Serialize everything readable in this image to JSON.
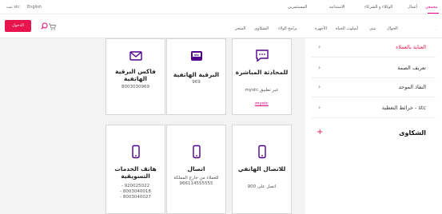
{
  "topbar": {
    "segments": [
      "مجمعي",
      "أعمال",
      "الوكلاء و الشركاء",
      "الاستدامة",
      "المستثمرين"
    ],
    "lang": "English",
    "stc_link": "stc تيت"
  },
  "header": {
    "brand": "stc",
    "nav": [
      "الجوال",
      "بيتي",
      "أسلوب الحياة",
      "الأجهزة",
      "برامج الولاء",
      "الشكاوى",
      "المتجر"
    ],
    "login": "الدخول"
  },
  "sidebar": {
    "items": [
      {
        "label": "العناية بالعملاء",
        "active": true
      },
      {
        "label": "تعريف الصمة",
        "active": false
      },
      {
        "label": "النفاذ الموحد",
        "active": false
      },
      {
        "label": "stc - خرائط التغطية",
        "active": false
      }
    ],
    "complaints": "الشكاوى"
  },
  "cards": [
    {
      "title": "للمحادثة المباشرة",
      "detail": "عبر تطبيق mystc",
      "link": "mystc",
      "icon": "chat-icon"
    },
    {
      "title": "البرقية الهاتفية",
      "detail": "969",
      "link": "",
      "icon": "telegram-icon"
    },
    {
      "title": "فاكس البرقية الهاتفية",
      "detail": "8003030969",
      "link": "",
      "icon": "fax-icon"
    },
    {
      "title": "للاتصال الهاتفي",
      "detail": "اتصل على 900",
      "link": "",
      "icon": "phone-icon"
    },
    {
      "title": "اتصال",
      "detail": "للعملاء من خارج المملكة 966114555555",
      "link": "",
      "icon": "phone-icon"
    },
    {
      "title": "هاتف الخدمات التسويقية",
      "detail": "920025022 - 8003040018 - 8003040027 -",
      "link": "",
      "icon": "phone-icon"
    }
  ],
  "colors": {
    "brand": "#e6007e",
    "accent": "#e8144d",
    "purple": "#4f008c"
  }
}
